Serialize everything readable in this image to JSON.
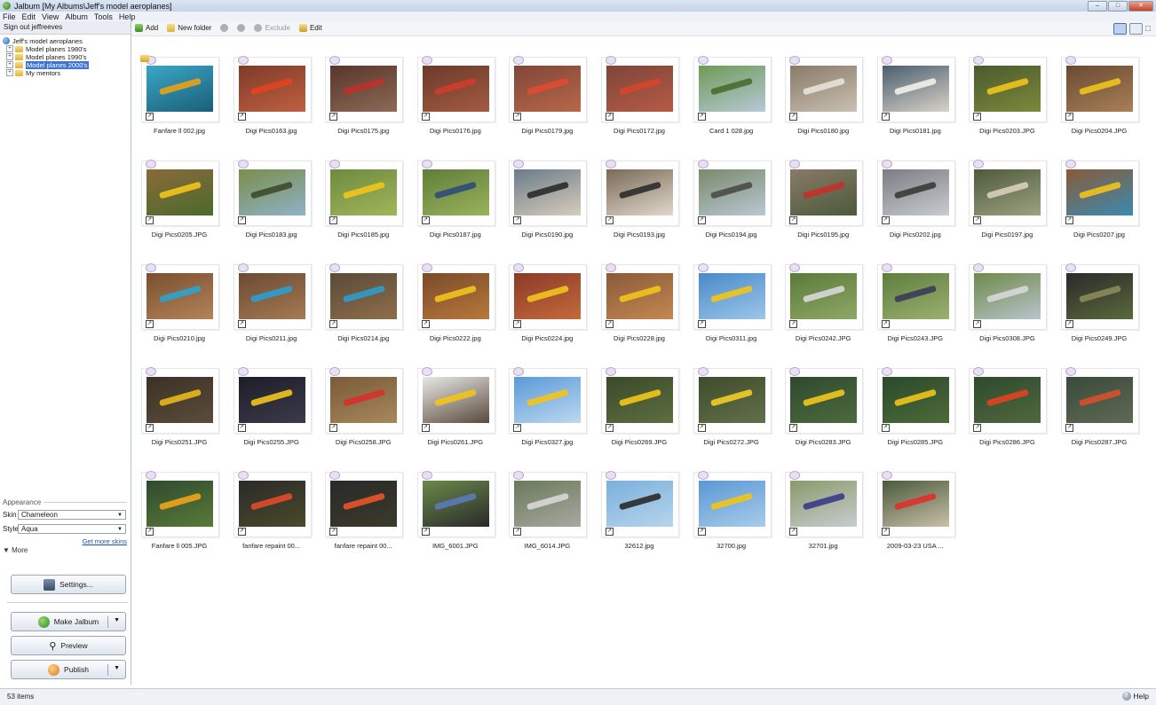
{
  "window": {
    "title": "Jalbum [My Albums\\Jeff's model aeroplanes]"
  },
  "menu": [
    "File",
    "Edit",
    "View",
    "Album",
    "Tools",
    "Help"
  ],
  "sidebar": {
    "signout": "Sign out jeffreeves",
    "tree": {
      "root": "Jeff's model aeroplanes",
      "items": [
        {
          "label": "Model planes  1980's",
          "selected": false
        },
        {
          "label": "Model planes  1990's",
          "selected": false
        },
        {
          "label": "Model planes 2000's",
          "selected": true
        },
        {
          "label": "My mentors",
          "selected": false
        }
      ]
    },
    "appearance": {
      "title": "Appearance",
      "skin_label": "Skin",
      "skin_value": "Chameleon",
      "style_label": "Style",
      "style_value": "Aqua",
      "get_more": "Get more skins",
      "more": "More",
      "settings": "Settings...",
      "make": "Make Jalbum",
      "preview": "Preview",
      "publish": "Publish"
    }
  },
  "toolbar": {
    "add": "Add",
    "new_folder": "New folder",
    "exclude": "Exclude",
    "edit": "Edit"
  },
  "items": [
    {
      "name": "Fanfare ll 002.jpg",
      "colors": [
        "#3aa7c6",
        "#1b5e78"
      ],
      "accent": "#e8a21a",
      "folder": true
    },
    {
      "name": "Digi Pics0163.jpg",
      "colors": [
        "#7d3b2a",
        "#c06040"
      ],
      "accent": "#e2421f",
      "folder": false
    },
    {
      "name": "Digi Pics0175.jpg",
      "colors": [
        "#58352a",
        "#8c6a55"
      ],
      "accent": "#c0302a",
      "folder": false
    },
    {
      "name": "Digi Pics0176.jpg",
      "colors": [
        "#6a3a2c",
        "#a45b40"
      ],
      "accent": "#d13b2a",
      "folder": false
    },
    {
      "name": "Digi Pics0179.jpg",
      "colors": [
        "#80463a",
        "#b86848"
      ],
      "accent": "#e04a32",
      "folder": false
    },
    {
      "name": "Digi Pics0172.jpg",
      "colors": [
        "#7c463a",
        "#b65b45"
      ],
      "accent": "#d8422a",
      "folder": false
    },
    {
      "name": "Card 1 028.jpg",
      "colors": [
        "#6e9a55",
        "#b7c9d8"
      ],
      "accent": "#4a6b2e",
      "folder": false
    },
    {
      "name": "Digi Pics0180.jpg",
      "colors": [
        "#8a7a68",
        "#c9c0b2"
      ],
      "accent": "#e8e2d8",
      "folder": false
    },
    {
      "name": "Digi Pics0181.jpg",
      "colors": [
        "#4b5e6e",
        "#d8d2c8"
      ],
      "accent": "#f2efe8",
      "folder": false
    },
    {
      "name": "Digi Pics0203.JPG",
      "colors": [
        "#4a5a2e",
        "#7c8a3a"
      ],
      "accent": "#f0c419",
      "folder": false
    },
    {
      "name": "Digi Pics0204.JPG",
      "colors": [
        "#6a4a34",
        "#a88056"
      ],
      "accent": "#f0c419",
      "folder": false
    },
    {
      "name": "Digi Pics0205.JPG",
      "colors": [
        "#8a6a3a",
        "#4b6a2c"
      ],
      "accent": "#f2c61a",
      "folder": false
    },
    {
      "name": "Digi Pics0183.jpg",
      "colors": [
        "#7a8e4a",
        "#8fb1c9"
      ],
      "accent": "#3c4a2a",
      "folder": false
    },
    {
      "name": "Digi Pics0185.jpg",
      "colors": [
        "#6e8a40",
        "#a0b65a"
      ],
      "accent": "#f2c41a",
      "folder": false
    },
    {
      "name": "Digi Pics0187.jpg",
      "colors": [
        "#5f7e3c",
        "#9ab25a"
      ],
      "accent": "#2f4a7a",
      "folder": false
    },
    {
      "name": "Digi Pics0190.jpg",
      "colors": [
        "#6a7c8a",
        "#d8ccbc"
      ],
      "accent": "#2a2a2a",
      "folder": false
    },
    {
      "name": "Digi Pics0193.jpg",
      "colors": [
        "#7a6a58",
        "#e0d8cc"
      ],
      "accent": "#2c2c2c",
      "folder": false
    },
    {
      "name": "Digi Pics0194.jpg",
      "colors": [
        "#7a8a6a",
        "#b9c7d4"
      ],
      "accent": "#4a4a4a",
      "folder": false
    },
    {
      "name": "Digi Pics0195.jpg",
      "colors": [
        "#8a7a68",
        "#4a5a3a"
      ],
      "accent": "#c4302a",
      "folder": false
    },
    {
      "name": "Digi Pics0202.jpg",
      "colors": [
        "#7a7e84",
        "#c8ccd0"
      ],
      "accent": "#3a3a3a",
      "folder": false
    },
    {
      "name": "Digi Pics0197.jpg",
      "colors": [
        "#4e5a3a",
        "#9ca282"
      ],
      "accent": "#d8cfb8",
      "folder": false
    },
    {
      "name": "Digi Pics0207.jpg",
      "colors": [
        "#8a5a3a",
        "#3a8ab0"
      ],
      "accent": "#f0c419",
      "folder": false
    },
    {
      "name": "Digi Pics0210.jpg",
      "colors": [
        "#7a4e30",
        "#b48458"
      ],
      "accent": "#2ea3d3",
      "folder": false
    },
    {
      "name": "Digi Pics0211.jpg",
      "colors": [
        "#6a4a34",
        "#a67a52"
      ],
      "accent": "#2ba0d0",
      "folder": false
    },
    {
      "name": "Digi Pics0214.jpg",
      "colors": [
        "#5a4a3a",
        "#8e6e4a"
      ],
      "accent": "#2d9ccc",
      "folder": false
    },
    {
      "name": "Digi Pics0222.jpg",
      "colors": [
        "#7a4a2a",
        "#b8783c"
      ],
      "accent": "#f2c41a",
      "folder": false
    },
    {
      "name": "Digi Pics0224.jpg",
      "colors": [
        "#8a3a2a",
        "#c46a3a"
      ],
      "accent": "#f2c41a",
      "folder": false
    },
    {
      "name": "Digi Pics0228.jpg",
      "colors": [
        "#8a5a3a",
        "#c48850"
      ],
      "accent": "#f2c41a",
      "folder": false
    },
    {
      "name": "Digi Pics0311.jpg",
      "colors": [
        "#4a8ac8",
        "#9cc6ea"
      ],
      "accent": "#f2c41a",
      "folder": false
    },
    {
      "name": "Digi Pics0242.JPG",
      "colors": [
        "#5a7a3a",
        "#8fa866"
      ],
      "accent": "#d8d8d8",
      "folder": false
    },
    {
      "name": "Digi Pics0243.JPG",
      "colors": [
        "#5e7e3e",
        "#9cb070"
      ],
      "accent": "#3a3a5a",
      "folder": false
    },
    {
      "name": "Digi Pics0308.JPG",
      "colors": [
        "#6e8a4a",
        "#b8c4cc"
      ],
      "accent": "#d8d8d8",
      "folder": false
    },
    {
      "name": "Digi Pics0249.JPG",
      "colors": [
        "#2a2a2a",
        "#5a6a3a"
      ],
      "accent": "#8a8a5a",
      "folder": false
    },
    {
      "name": "Digi Pics0251.JPG",
      "colors": [
        "#3a3226",
        "#5c4c3a"
      ],
      "accent": "#e8b81a",
      "folder": false
    },
    {
      "name": "Digi Pics0255.JPG",
      "colors": [
        "#1e1e2a",
        "#3a3a4a"
      ],
      "accent": "#f2c41a",
      "folder": false
    },
    {
      "name": "Digi Pics0258.JPG",
      "colors": [
        "#7a5a3a",
        "#a8885a"
      ],
      "accent": "#d8302a",
      "folder": false
    },
    {
      "name": "Digi Pics0261.JPG",
      "colors": [
        "#e8e8e8",
        "#5a4a3a"
      ],
      "accent": "#f2c41a",
      "folder": false
    },
    {
      "name": "Digi Pics0327.jpg",
      "colors": [
        "#5a9ad8",
        "#bcd8f0"
      ],
      "accent": "#f2c41a",
      "folder": false
    },
    {
      "name": "Digi Pics0269.JPG",
      "colors": [
        "#3a4a2a",
        "#5e6e40"
      ],
      "accent": "#f2c81a",
      "folder": false
    },
    {
      "name": "Digi Pics0272.JPG",
      "colors": [
        "#3e4c2c",
        "#62704a"
      ],
      "accent": "#f4cc22",
      "folder": false
    },
    {
      "name": "Digi Pics0283.JPG",
      "colors": [
        "#2e4a2e",
        "#4e6a3e"
      ],
      "accent": "#f2c81a",
      "folder": false
    },
    {
      "name": "Digi Pics0285.JPG",
      "colors": [
        "#2a4a2a",
        "#4e6a3a"
      ],
      "accent": "#f2c41a",
      "folder": false
    },
    {
      "name": "Digi Pics0286.JPG",
      "colors": [
        "#2e4a2e",
        "#50683e"
      ],
      "accent": "#e2421f",
      "folder": false
    },
    {
      "name": "Digi Pics0287.JPG",
      "colors": [
        "#3a4a3a",
        "#5e6a54"
      ],
      "accent": "#d8502a",
      "folder": false
    },
    {
      "name": "Fanfare ll 005.JPG",
      "colors": [
        "#2e4a2e",
        "#5a7a3a"
      ],
      "accent": "#f2a41a",
      "folder": false
    },
    {
      "name": "fanfare repaint 00...",
      "colors": [
        "#2a2a2a",
        "#4a4a2a"
      ],
      "accent": "#e04a2a",
      "folder": false
    },
    {
      "name": "fanfare repaint 00...",
      "colors": [
        "#2a2a2a",
        "#3a3a2a"
      ],
      "accent": "#e8542a",
      "folder": false
    },
    {
      "name": "IMG_6001.JPG",
      "colors": [
        "#6a8a4a",
        "#2a2a2a"
      ],
      "accent": "#5a7ab8",
      "folder": false
    },
    {
      "name": "IMG_6014.JPG",
      "colors": [
        "#6a7a5a",
        "#a8a8a0"
      ],
      "accent": "#d8d8d8",
      "folder": false
    },
    {
      "name": "32612.jpg",
      "colors": [
        "#7ab0dc",
        "#b8d4ec"
      ],
      "accent": "#2a2a2a",
      "folder": false
    },
    {
      "name": "32700.jpg",
      "colors": [
        "#5a98d4",
        "#a8cbea"
      ],
      "accent": "#f2c41a",
      "folder": false
    },
    {
      "name": "32701.jpg",
      "colors": [
        "#8a9a6a",
        "#c8ccd0"
      ],
      "accent": "#3a3a8a",
      "folder": false
    },
    {
      "name": "2009-03-23 USA ...",
      "colors": [
        "#4a5a3a",
        "#c8c0a8"
      ],
      "accent": "#e0302a",
      "folder": false
    }
  ],
  "status": {
    "count": "53 items",
    "help": "Help"
  }
}
